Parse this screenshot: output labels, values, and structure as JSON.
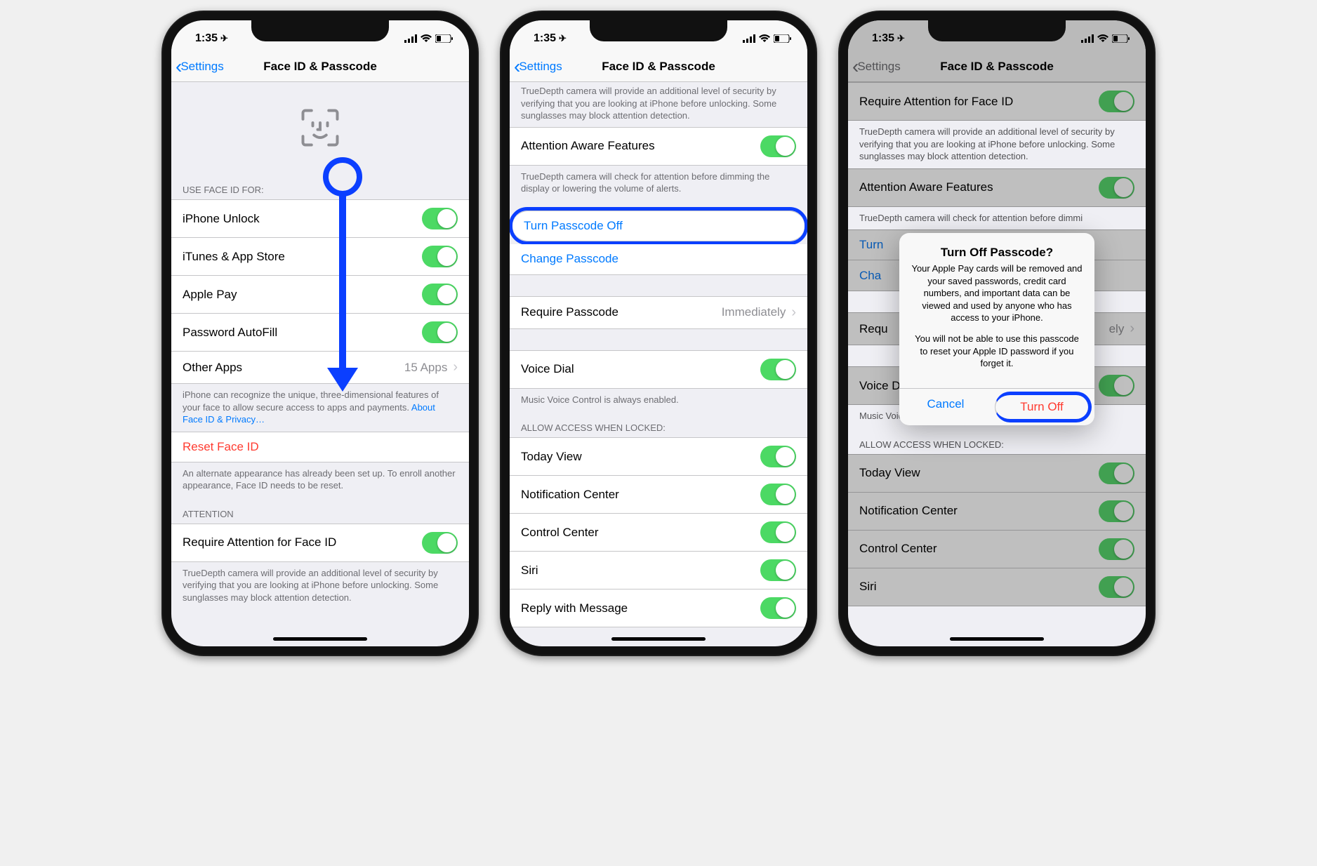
{
  "status": {
    "time": "1:35",
    "location_arrow": "➤"
  },
  "nav": {
    "back": "Settings",
    "title": "Face ID & Passcode"
  },
  "phone1": {
    "section_useFor": "USE FACE ID FOR:",
    "items": [
      {
        "label": "iPhone Unlock",
        "on": true
      },
      {
        "label": "iTunes & App Store",
        "on": true
      },
      {
        "label": "Apple Pay",
        "on": true
      },
      {
        "label": "Password AutoFill",
        "on": true
      }
    ],
    "otherApps": {
      "label": "Other Apps",
      "detail": "15 Apps"
    },
    "footer_useFor": "iPhone can recognize the unique, three-dimensional features of your face to allow secure access to apps and payments. ",
    "footer_link": "About Face ID & Privacy…",
    "reset": "Reset Face ID",
    "footer_reset": "An alternate appearance has already been set up. To enroll another appearance, Face ID needs to be reset.",
    "section_attention": "ATTENTION",
    "requireAttention": "Require Attention for Face ID",
    "footer_attention": "TrueDepth camera will provide an additional level of security by verifying that you are looking at iPhone before unlocking. Some sunglasses may block attention detection."
  },
  "phone2": {
    "truncated_top": "TrueDepth camera will provide an additional level of security by verifying that you are looking at iPhone before unlocking. Some sunglasses may block attention detection.",
    "attentionAware": "Attention Aware Features",
    "footer_aware": "TrueDepth camera will check for attention before dimming the display or lowering the volume of alerts.",
    "turnOff": "Turn Passcode Off",
    "change": "Change Passcode",
    "require": {
      "label": "Require Passcode",
      "detail": "Immediately"
    },
    "voiceDial": "Voice Dial",
    "footer_voice": "Music Voice Control is always enabled.",
    "section_allow": "ALLOW ACCESS WHEN LOCKED:",
    "allow": [
      "Today View",
      "Notification Center",
      "Control Center",
      "Siri",
      "Reply with Message"
    ]
  },
  "phone3": {
    "requireAttention": "Require Attention for Face ID",
    "footer_attention": "TrueDepth camera will provide an additional level of security by verifying that you are looking at iPhone before unlocking. Some sunglasses may block attention detection.",
    "attentionAware": "Attention Aware Features",
    "footer_aware_truncated": "TrueDepth camera will check for attention before dimmi",
    "turn_short": "Turn",
    "cha_short": "Cha",
    "require": {
      "label": "Requ",
      "detail": "ely"
    },
    "voiceDial": "Voice Dial",
    "footer_voice": "Music Voice Control is always enabled.",
    "section_allow": "ALLOW ACCESS WHEN LOCKED:",
    "allow": [
      "Today View",
      "Notification Center",
      "Control Center",
      "Siri"
    ],
    "alert": {
      "title": "Turn Off Passcode?",
      "msg1": "Your Apple Pay cards will be removed and your saved passwords, credit card numbers, and important data can be viewed and used by anyone who has access to your iPhone.",
      "msg2": "You will not be able to use this passcode to reset your Apple ID password if you forget it.",
      "cancel": "Cancel",
      "turnoff": "Turn Off"
    }
  }
}
